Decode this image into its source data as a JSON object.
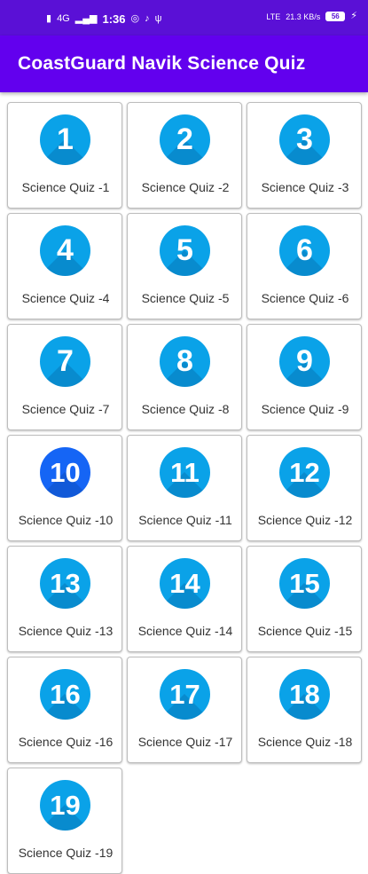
{
  "status_bar": {
    "time": "1:36",
    "network_left": "4G",
    "network_right": "LTE",
    "speed": "21.3 KB/s",
    "battery": "56"
  },
  "app": {
    "title": "CoastGuard Navik Science Quiz",
    "theme_color": "#6200ee",
    "status_color": "#5a10d6"
  },
  "quizzes": [
    {
      "num": "1",
      "label": "Science Quiz -1"
    },
    {
      "num": "2",
      "label": "Science Quiz -2"
    },
    {
      "num": "3",
      "label": "Science Quiz -3"
    },
    {
      "num": "4",
      "label": "Science Quiz -4"
    },
    {
      "num": "5",
      "label": "Science Quiz -5"
    },
    {
      "num": "6",
      "label": "Science Quiz -6"
    },
    {
      "num": "7",
      "label": "Science Quiz -7"
    },
    {
      "num": "8",
      "label": "Science Quiz -8"
    },
    {
      "num": "9",
      "label": "Science Quiz -9"
    },
    {
      "num": "10",
      "label": "Science Quiz -10",
      "selected": true
    },
    {
      "num": "11",
      "label": "Science Quiz -11"
    },
    {
      "num": "12",
      "label": "Science Quiz -12"
    },
    {
      "num": "13",
      "label": "Science Quiz -13"
    },
    {
      "num": "14",
      "label": "Science Quiz -14"
    },
    {
      "num": "15",
      "label": "Science Quiz -15"
    },
    {
      "num": "16",
      "label": "Science Quiz -16"
    },
    {
      "num": "17",
      "label": "Science Quiz -17"
    },
    {
      "num": "18",
      "label": "Science Quiz -18"
    },
    {
      "num": "19",
      "label": "Science Quiz -19"
    }
  ]
}
